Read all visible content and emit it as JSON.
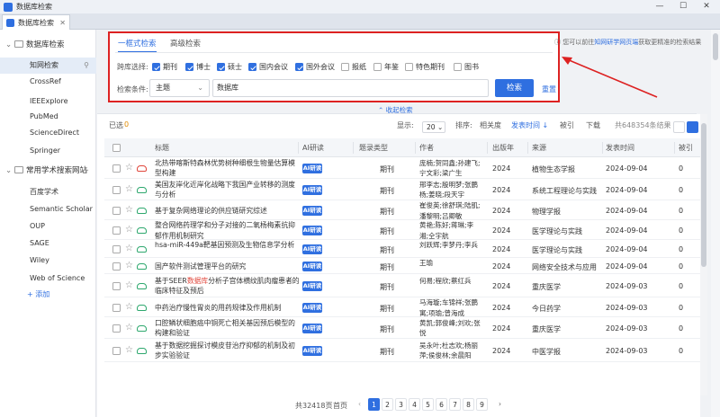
{
  "window": {
    "title": "数据库检索",
    "minimize": "—",
    "maximize": "☐",
    "close": "✕"
  },
  "tabs": [
    {
      "label": "数据库检索",
      "close": "✕"
    }
  ],
  "sidebar": {
    "section1": {
      "label": "数据库检索",
      "caret": "⌄"
    },
    "databases": [
      "知网检索",
      "CrossRef",
      "IEEExplore",
      "PubMed",
      "ScienceDirect",
      "Springer"
    ],
    "section2": {
      "label": "常用学术搜索网站",
      "add": "+",
      "caret": "⌄"
    },
    "sites": [
      "百度学术",
      "Semantic Scholar",
      "OUP",
      "SAGE",
      "Wiley",
      "Web of Science"
    ],
    "add_label": "+ 添加"
  },
  "search": {
    "tabs": [
      "一框式检索",
      "高级检索"
    ],
    "cross_label": "跨库选择:",
    "sources": [
      {
        "label": "期刊",
        "checked": true
      },
      {
        "label": "博士",
        "checked": true
      },
      {
        "label": "硕士",
        "checked": true
      },
      {
        "label": "国内会议",
        "checked": true
      },
      {
        "label": "国外会议",
        "checked": true
      },
      {
        "label": "报纸",
        "checked": false
      },
      {
        "label": "年鉴",
        "checked": false
      },
      {
        "label": "特色期刊",
        "checked": false
      },
      {
        "label": "图书",
        "checked": false
      }
    ],
    "cond_label": "检索条件:",
    "field": "主题",
    "keyword": "数据库",
    "search_button": "检索",
    "reset": "重置",
    "hint_pre": "您可以前往",
    "hint_link": "知网研学网页端",
    "hint_post": "获取更精准的检索结果",
    "collapse": "⌃ 收起检索"
  },
  "toolbar": {
    "selected_label": "已选",
    "selected_count": "0",
    "display_label": "显示:",
    "page_size": "20",
    "sort_label": "排序:",
    "sort_options": [
      "相关度",
      "发表时间 ↓",
      "被引",
      "下载"
    ],
    "total": "共648354条结果"
  },
  "table": {
    "headers": [
      "标题",
      "AI研读",
      "题录类型",
      "作者",
      "出版年",
      "来源",
      "发表时间",
      "被引"
    ],
    "ai_badge": "AI研读",
    "rows": [
      {
        "title": "北热带喀斯特森林优势树种细根生物量估算模型构建",
        "hl": "",
        "type": "期刊",
        "authors": "庞楠;贺同鑫;孙建飞;宁文彩;梁广生",
        "year": "2024",
        "source": "植物生态学报",
        "date": "2024-09-04",
        "cited": "0",
        "cloud": "red"
      },
      {
        "title": "美国友岸化近岸化战略下我国产业转移的测度与分析",
        "hl": "",
        "type": "期刊",
        "authors": "邢李志;殷明梦;张鹏杨;姜晓;段天宇",
        "year": "2024",
        "source": "系统工程理论与实践",
        "date": "2024-09-04",
        "cited": "0",
        "cloud": "green"
      },
      {
        "title": "基于复杂网络理论的供应链研究综述",
        "hl": "",
        "type": "期刊",
        "authors": "崔俊英;徐舒琪;陆肌;潘黎明;吕卿敏",
        "year": "2024",
        "source": "物理学报",
        "date": "2024-09-04",
        "cited": "0",
        "cloud": "green"
      },
      {
        "title": "整合网络药理学和分子对接的二氧杨梅素抗抑郁作用机制研究",
        "hl": "",
        "type": "期刊",
        "authors": "黄艳;陈好;蒋琳;李湘;仝宇航",
        "year": "2024",
        "source": "医学理论与实践",
        "date": "2024-09-04",
        "cited": "0",
        "cloud": "green"
      },
      {
        "title": "hsa-miR-449a靶基因预测及生物信息学分析",
        "hl": "",
        "type": "期刊",
        "authors": "刘跃辉;李梦丹;李兵",
        "year": "2024",
        "source": "医学理论与实践",
        "date": "2024-09-04",
        "cited": "0",
        "cloud": "green"
      },
      {
        "title": "国产软件测试管理平台的研究",
        "hl": "",
        "type": "期刊",
        "authors": "王瑜",
        "year": "2024",
        "source": "网络安全技术与应用",
        "date": "2024-09-04",
        "cited": "0",
        "cloud": "green"
      },
      {
        "title": "基于SEER数据库分析子宫体横纹肌肉瘤患者的临床特征及预后",
        "hl": "数据库",
        "type": "期刊",
        "authors": "何易;程欣;蔡红兵",
        "year": "2024",
        "source": "重庆医学",
        "date": "2024-09-03",
        "cited": "0",
        "cloud": "green"
      },
      {
        "title": "中药治疗慢性胃炎的用药规律及作用机制",
        "hl": "",
        "type": "期刊",
        "authors": "马海璇;车锦祥;张鹏寓;项瑜;曾海成",
        "year": "2024",
        "source": "今日药学",
        "date": "2024-09-03",
        "cited": "0",
        "cloud": "green"
      },
      {
        "title": "口腔鳞状细胞癌中铜死亡相关基因预后模型的构建和验证",
        "hl": "",
        "type": "期刊",
        "authors": "黄凯;郭俊峰;刘欢;张悦",
        "year": "2024",
        "source": "重庆医学",
        "date": "2024-09-03",
        "cited": "0",
        "cloud": "green"
      },
      {
        "title": "基于数据挖掘探讨模皮苷治疗抑郁的机制及初步实验验证",
        "hl": "",
        "type": "期刊",
        "authors": "吴永叶;杜志欢;杨丽萍;侯俊林;余晨阳",
        "year": "2024",
        "source": "中医学报",
        "date": "2024-09-03",
        "cited": "0",
        "cloud": "green"
      }
    ]
  },
  "pagination": {
    "total": "共32418页",
    "first": "首页",
    "prev": "‹",
    "pages": [
      "1",
      "2",
      "3",
      "4",
      "5",
      "6",
      "7",
      "8",
      "9"
    ],
    "next": "›",
    "current": 1
  }
}
